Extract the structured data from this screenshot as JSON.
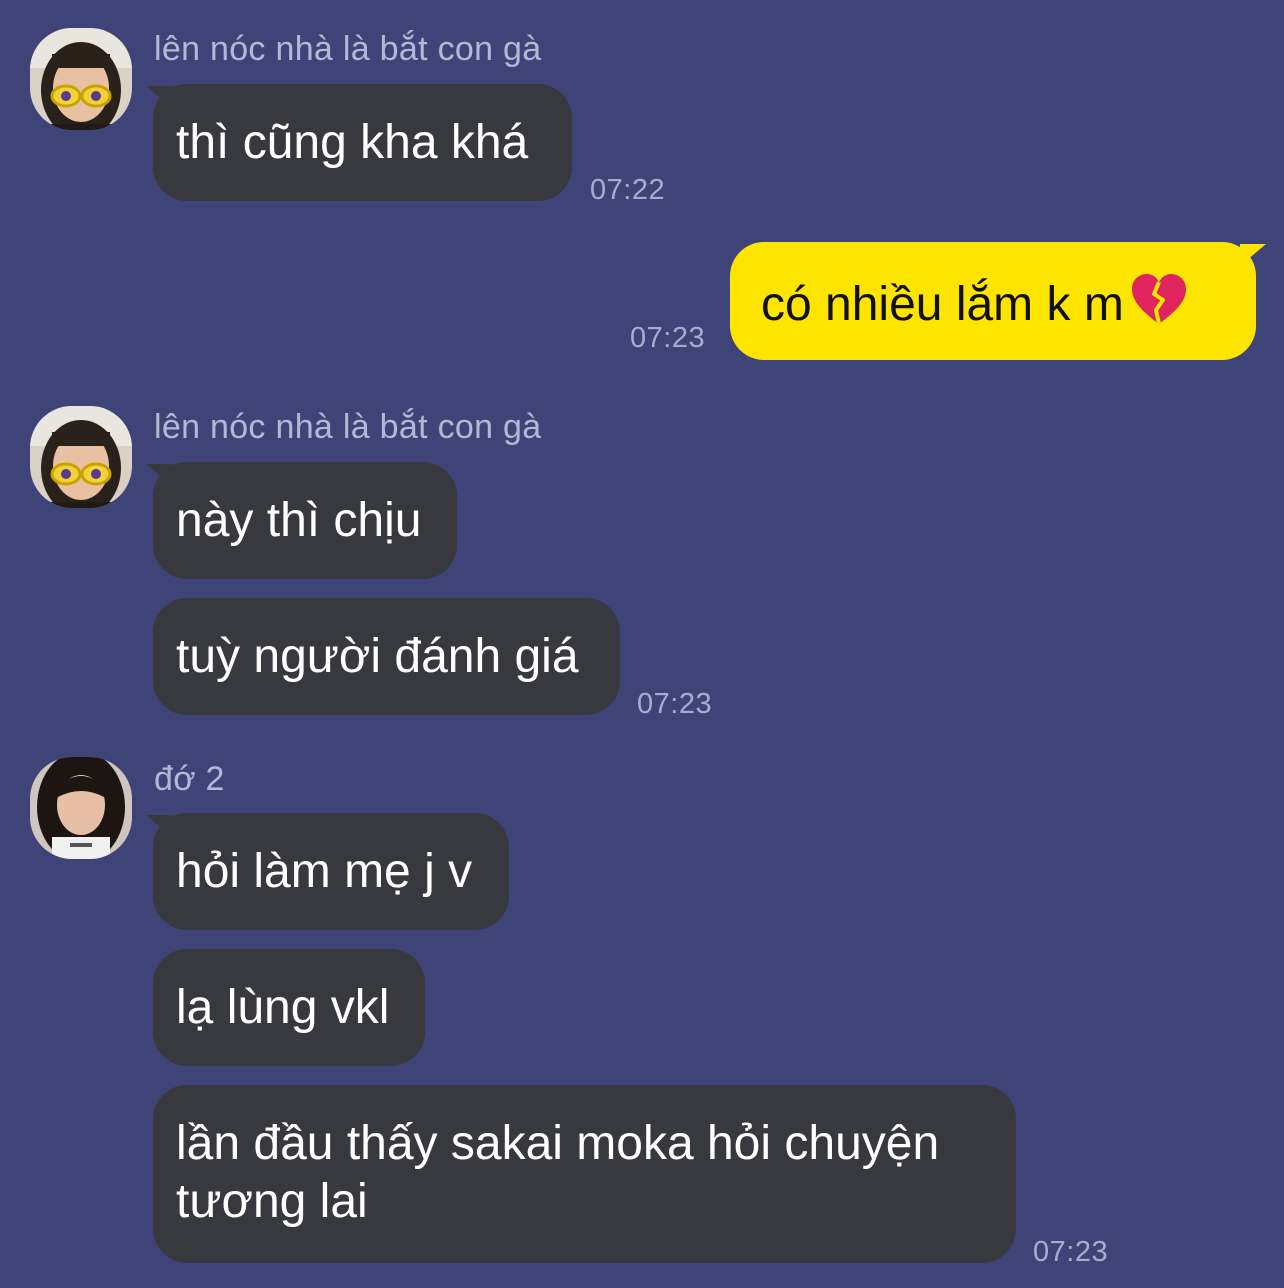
{
  "messages": [
    {
      "sender": "lên nóc nhà là bắt con gà",
      "texts": [
        "thì cũng kha khá"
      ],
      "time": "07:22"
    },
    {
      "sender": "me",
      "texts": [
        "có nhiều lắm k m"
      ],
      "emoji": "broken-heart-icon",
      "time": "07:23"
    },
    {
      "sender": "lên nóc nhà là bắt con gà",
      "texts": [
        "này thì chịu",
        "tuỳ người đánh giá"
      ],
      "time": "07:23"
    },
    {
      "sender": "đớ 2",
      "texts": [
        "hỏi làm mẹ j v",
        "lạ lùng vkl",
        "lần đầu thấy sakai moka hỏi chuyện tương lai"
      ],
      "time": "07:23"
    }
  ],
  "colors": {
    "background": "#3f4478",
    "incoming_bubble": "#38383f",
    "outgoing_bubble": "#fee500",
    "sender_name": "#b5b7d6",
    "timestamp": "#a9abcf"
  }
}
